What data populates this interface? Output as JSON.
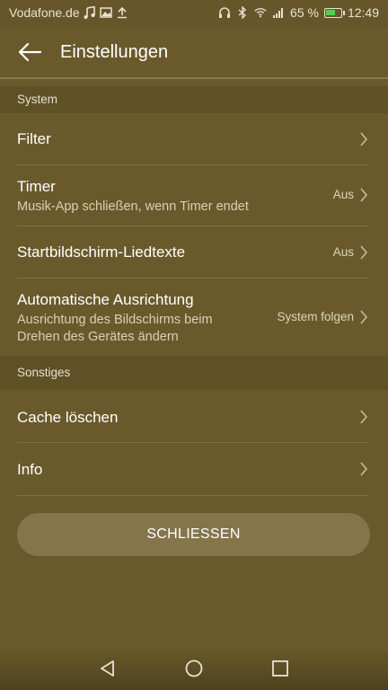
{
  "status": {
    "carrier": "Vodafone.de",
    "battery": "65 %",
    "battery_level": 0.65,
    "time": "12:49"
  },
  "header": {
    "title": "Einstellungen"
  },
  "sections": {
    "system": "System",
    "other": "Sonstiges"
  },
  "items": {
    "filter": {
      "label": "Filter"
    },
    "timer": {
      "label": "Timer",
      "sub": "Musik-App schließen, wenn Timer endet",
      "value": "Aus"
    },
    "lyrics": {
      "label": "Startbildschirm-Liedtexte",
      "value": "Aus"
    },
    "rotation": {
      "label": "Automatische Ausrichtung",
      "sub1": "Ausrichtung des Bildschirms beim",
      "sub2": "Drehen des Gerätes ändern",
      "value": "System folgen"
    },
    "cache": {
      "label": "Cache löschen"
    },
    "info": {
      "label": "Info"
    }
  },
  "close_button": "SCHLIESSEN",
  "colors": {
    "background": "#6a5a2b",
    "section_bg": "#5f5026",
    "button_bg": "#85754b",
    "battery_fill": "#53d04a"
  }
}
